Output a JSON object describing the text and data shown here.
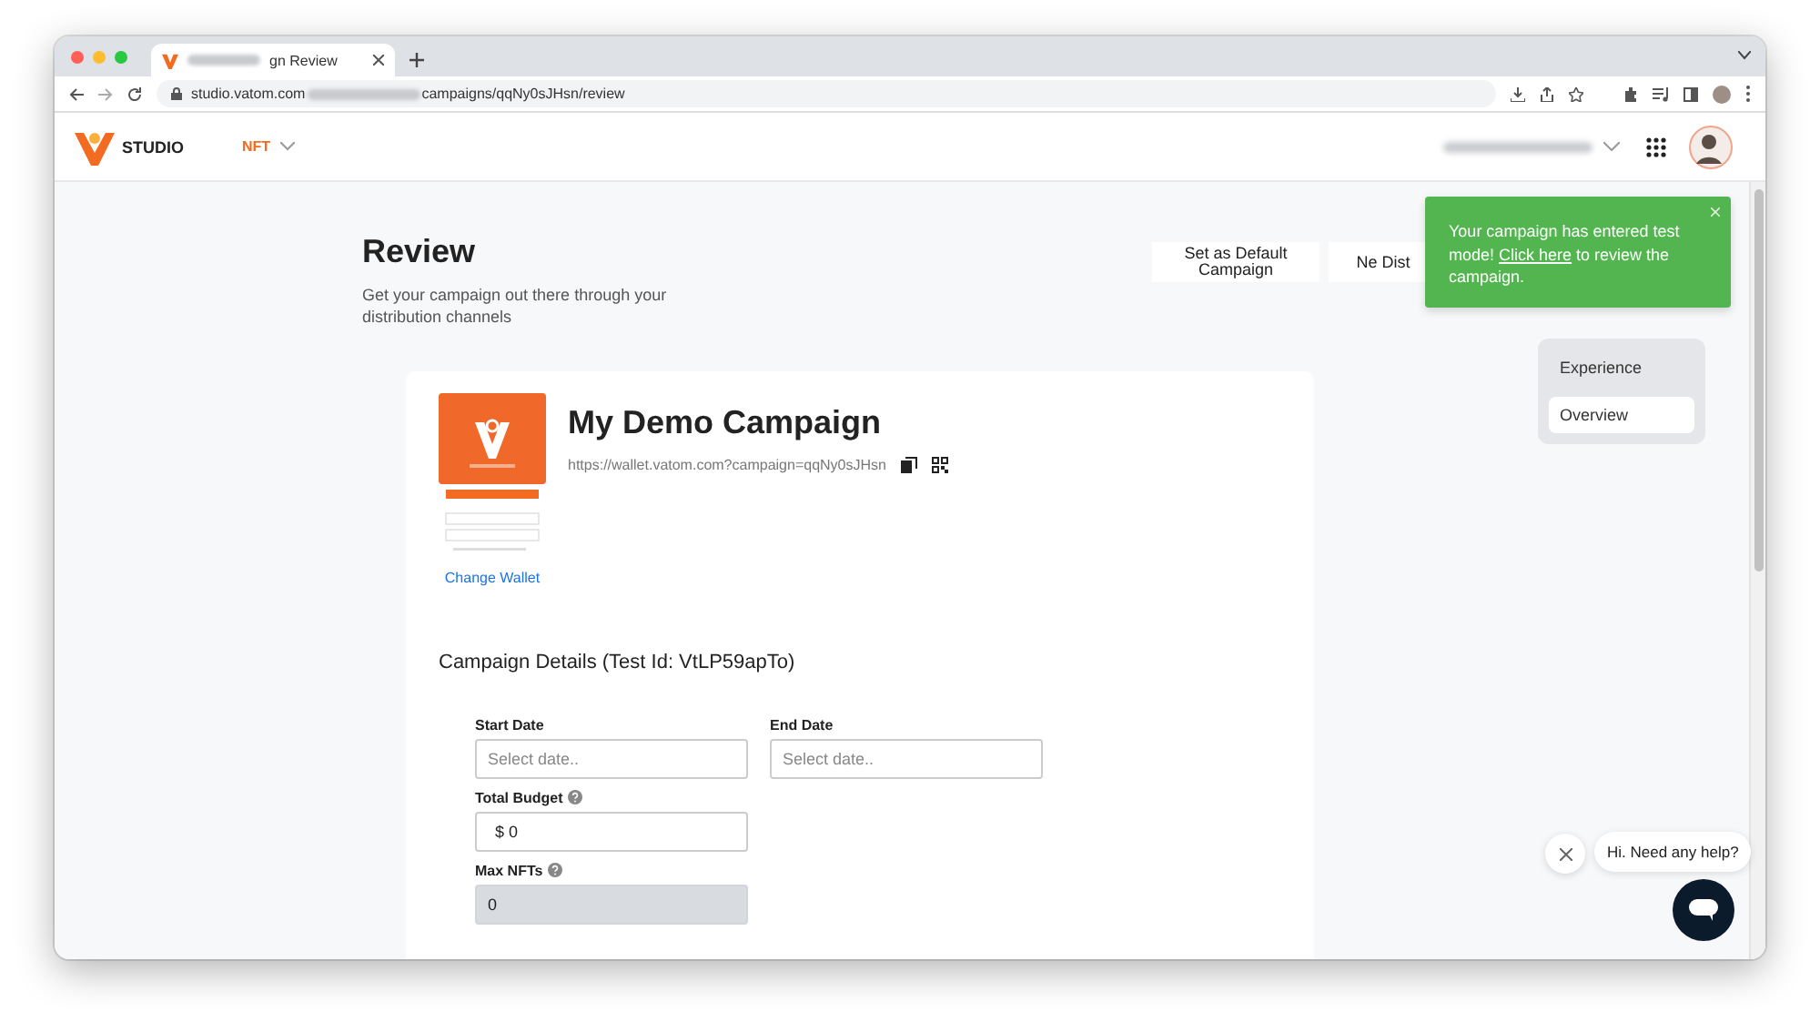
{
  "browser": {
    "tab_title": "gn Review",
    "url_host": "studio.vatom.com",
    "url_path": "campaigns/qqNy0sJHsn/review"
  },
  "app_header": {
    "logo_text": "STUDIO",
    "menu": "NFT"
  },
  "page": {
    "title": "Review",
    "subtitle": "Get your campaign out there through your distribution channels",
    "actions": [
      {
        "label": "Set as Default Campaign"
      },
      {
        "label": "Ne Dist"
      }
    ]
  },
  "toast": {
    "before": "Your campaign has entered test mode! ",
    "link": "Click here",
    "after": " to review the campaign."
  },
  "side_nav": [
    {
      "label": "Experience",
      "selected": false
    },
    {
      "label": "Overview",
      "selected": true
    }
  ],
  "campaign": {
    "name": "My Demo Campaign",
    "url": "https://wallet.vatom.com?campaign=qqNy0sJHsn",
    "change_wallet": "Change Wallet",
    "details_heading": "Campaign Details (Test Id: VtLP59apTo)",
    "fields": [
      {
        "label": "Start Date",
        "kind": "date",
        "placeholder": "Select date..",
        "help": false,
        "disabled": false
      },
      {
        "label": "End Date",
        "kind": "date",
        "placeholder": "Select date..",
        "help": false,
        "disabled": false
      },
      {
        "label": "Total Budget",
        "kind": "currency",
        "prefix": "$",
        "value": "0",
        "help": true,
        "disabled": false
      },
      {
        "label": "Max NFTs",
        "kind": "number",
        "value": "0",
        "help": true,
        "disabled": true
      }
    ]
  },
  "chat": {
    "message": "Hi. Need any help?"
  }
}
